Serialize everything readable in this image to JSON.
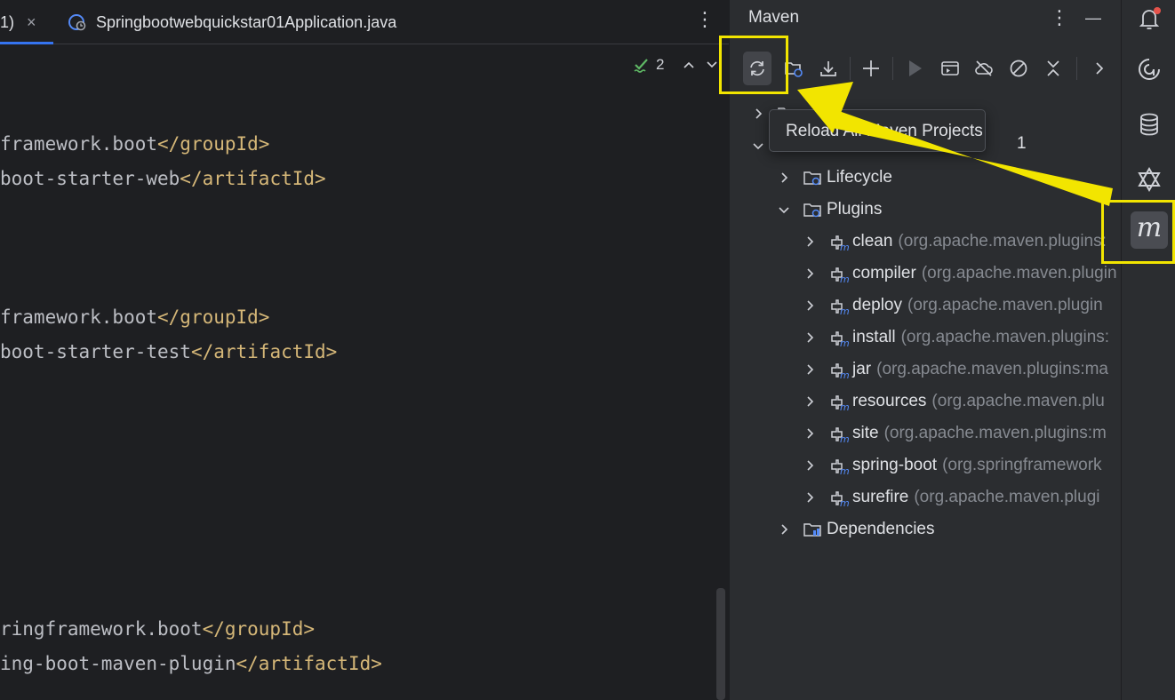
{
  "editor": {
    "tabs": [
      {
        "label": "1)",
        "close": "×"
      },
      {
        "label": "Springbootwebquickstar01Application.java"
      }
    ],
    "tab_menu": "⋮",
    "inspection_count": "2",
    "code_lines": [
      {
        "text": "framework.boot",
        "tag": "</groupId>"
      },
      {
        "text": "boot-starter-web",
        "tag": "</artifactId>"
      },
      {
        "text": "framework.boot",
        "tag": "</groupId>"
      },
      {
        "text": "boot-starter-test",
        "tag": "</artifactId>"
      },
      {
        "text": "ringframework.boot",
        "tag": "</groupId>"
      },
      {
        "text": "ing-boot-maven-plugin",
        "tag": "</artifactId>"
      }
    ]
  },
  "maven": {
    "title": "Maven",
    "header_menu": "⋮",
    "header_minimize": "—",
    "tooltip": "Reload All Maven Projects",
    "partial_row_suffix": "1",
    "tree": [
      {
        "name": "Lifecycle",
        "sub": ""
      },
      {
        "name": "Plugins",
        "sub": ""
      },
      {
        "name": "clean",
        "sub": "(org.apache.maven.plugins:"
      },
      {
        "name": "compiler",
        "sub": "(org.apache.maven.plugin"
      },
      {
        "name": "deploy",
        "sub": "(org.apache.maven.plugin"
      },
      {
        "name": "install",
        "sub": "(org.apache.maven.plugins:"
      },
      {
        "name": "jar",
        "sub": "(org.apache.maven.plugins:ma"
      },
      {
        "name": "resources",
        "sub": "(org.apache.maven.plu"
      },
      {
        "name": "site",
        "sub": "(org.apache.maven.plugins:m"
      },
      {
        "name": "spring-boot",
        "sub": "(org.springframework"
      },
      {
        "name": "surefire",
        "sub": "(org.apache.maven.plugi"
      },
      {
        "name": "Dependencies",
        "sub": ""
      }
    ]
  },
  "colors": {
    "highlight": "#f2e500",
    "accent": "#3574f0",
    "xml_tag": "#d5b778"
  }
}
